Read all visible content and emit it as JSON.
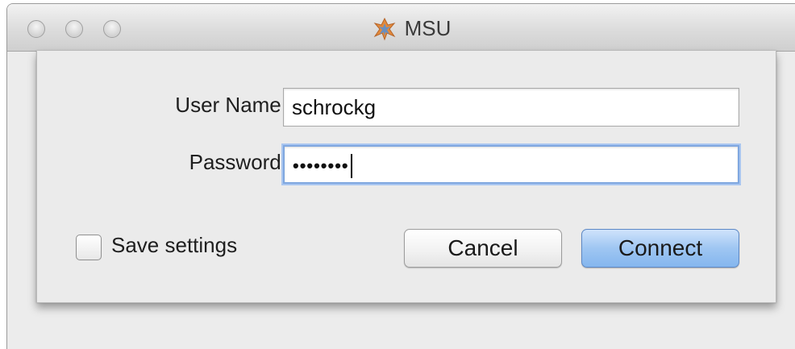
{
  "window": {
    "title": "MSU",
    "app_icon": "msu-app-icon",
    "window_controls": [
      "close-icon",
      "minimize-icon",
      "zoom-icon"
    ]
  },
  "form": {
    "username_label": "User Name:",
    "username_value": "schrockg",
    "password_label": "Password:",
    "password_masked": "••••••••",
    "save_settings_label": "Save settings",
    "save_settings_checked": false
  },
  "buttons": {
    "cancel_label": "Cancel",
    "connect_label": "Connect"
  },
  "colors": {
    "focus_ring": "#7fa7e0",
    "default_button": "#9fc6f2",
    "window_bg": "#ececec"
  }
}
